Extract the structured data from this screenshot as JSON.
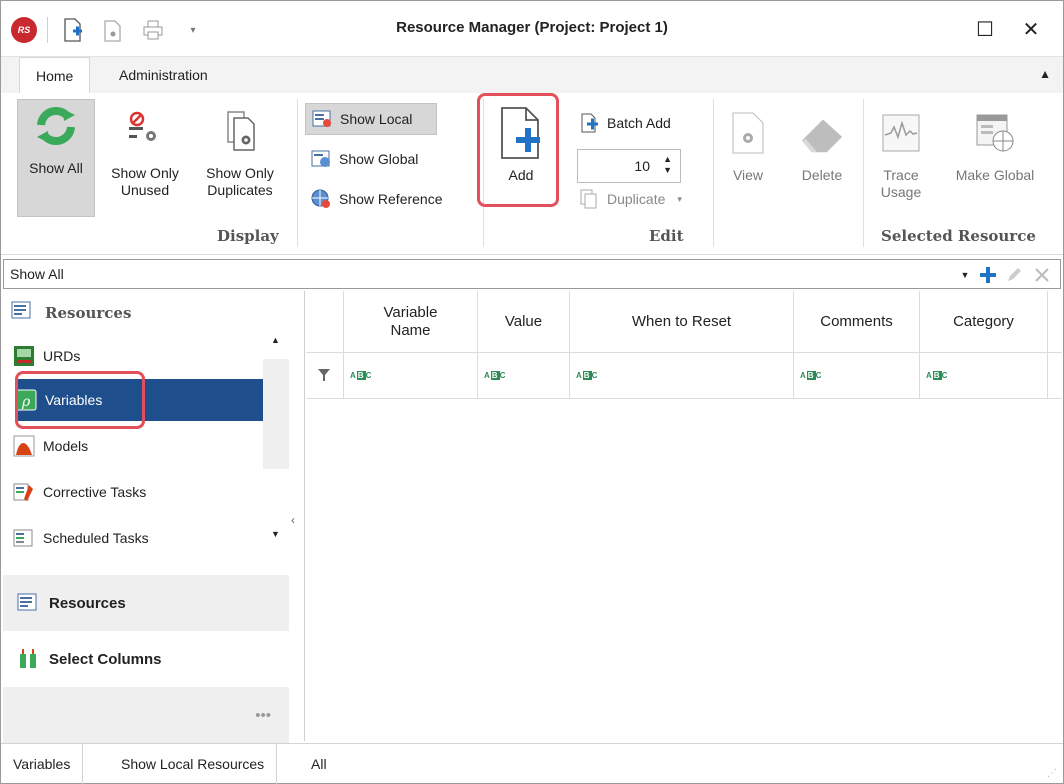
{
  "window": {
    "title": "Resource Manager (Project: Project 1)",
    "logo_text": "RS",
    "maximize_icon": "☐",
    "close_icon": "✕"
  },
  "ribbon": {
    "tabs": [
      {
        "label": "Home",
        "active": true
      },
      {
        "label": "Administration",
        "active": false
      }
    ],
    "collapse_icon": "chevron-up-icon",
    "display": {
      "group_label": "Display",
      "show_all": "Show All",
      "show_only_unused": "Show Only\nUnused",
      "show_only_duplicates": "Show Only\nDuplicates",
      "show_local": "Show Local",
      "show_global": "Show Global",
      "show_reference": "Show Reference"
    },
    "edit": {
      "group_label": "Edit",
      "add": "Add",
      "batch_add": "Batch Add",
      "batch_count": "10",
      "duplicate": "Duplicate",
      "view": "View",
      "delete": "Delete"
    },
    "selected_resource": {
      "group_label": "Selected Resource",
      "trace_usage": "Trace\nUsage",
      "make_global": "Make Global"
    }
  },
  "filter_bar": {
    "value": "Show All"
  },
  "nav": {
    "header": "Resources",
    "items": [
      {
        "label": "URDs",
        "icon": "urd-icon"
      },
      {
        "label": "Variables",
        "icon": "variable-icon",
        "selected": true
      },
      {
        "label": "Models",
        "icon": "model-icon"
      },
      {
        "label": "Corrective Tasks",
        "icon": "corrective-task-icon"
      },
      {
        "label": "Scheduled Tasks",
        "icon": "scheduled-task-icon"
      }
    ],
    "panels": [
      {
        "label": "Resources"
      },
      {
        "label": "Select Columns"
      }
    ],
    "more": "•••"
  },
  "grid": {
    "columns": [
      "Variable\nName",
      "Value",
      "When to Reset",
      "Comments",
      "Category"
    ],
    "filter_glyph": "ABC",
    "rows": []
  },
  "status_bar": {
    "items": [
      "Variables",
      "Show Local Resources",
      "All"
    ]
  },
  "colors": {
    "accent_red": "#e2505b",
    "selection_blue": "#1f4e8c",
    "plus_blue": "#1f72c4",
    "refresh_green": "#3aa95a"
  }
}
